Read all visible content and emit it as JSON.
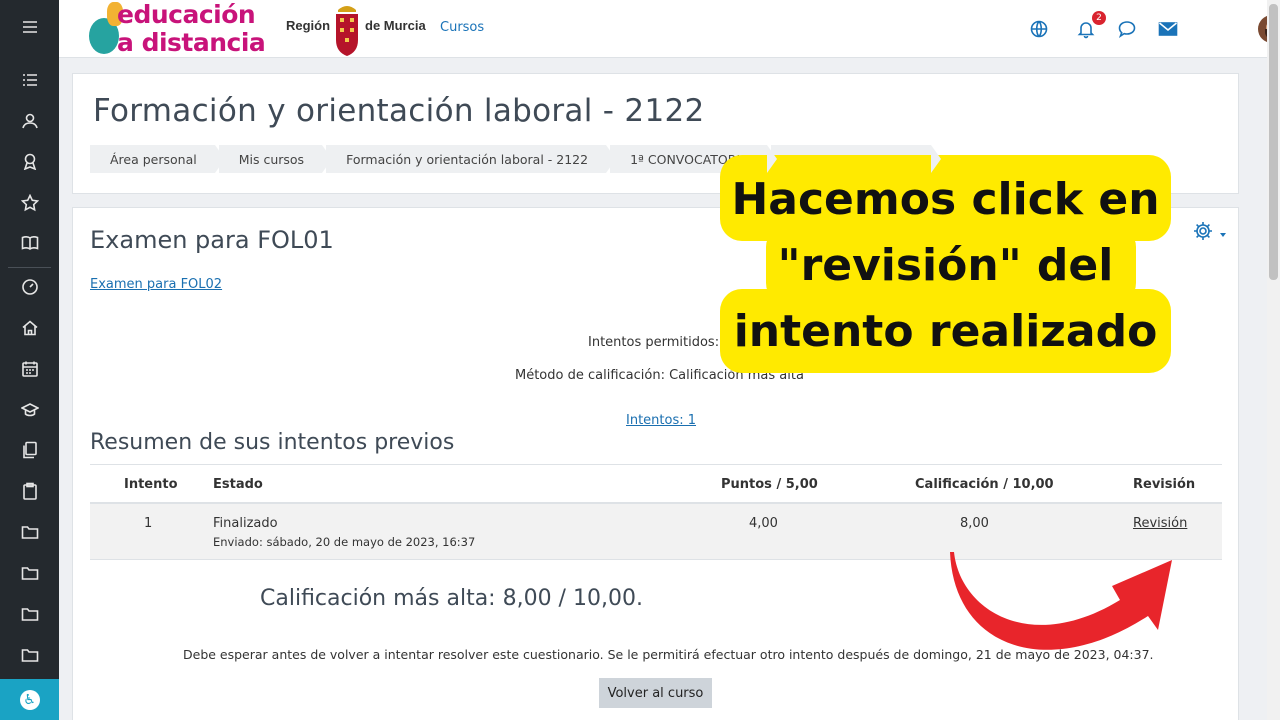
{
  "navbar": {
    "logo_line1": "educación",
    "logo_line2": "a distancia",
    "region_left": "Región",
    "region_right": "de Murcia",
    "cursos_link": "Cursos",
    "notification_count": "2"
  },
  "header": {
    "title": "Formación y orientación laboral - 2122",
    "breadcrumbs": [
      "Área personal",
      "Mis cursos",
      "Formación y orientación laboral - 2122",
      "1ª CONVOCATORIA"
    ]
  },
  "quiz": {
    "title": "Examen para FOL01",
    "next_link": "Examen para FOL02",
    "attempts_allowed": "Intentos permitidos: 3",
    "grading_method": "Método de calificación: Calificación más alta",
    "attempts_link": "Intentos: 1",
    "summary_title": "Resumen de sus intentos previos",
    "table": {
      "headers": [
        "Intento",
        "Estado",
        "Puntos / 5,00",
        "Calificación / 10,00",
        "Revisión"
      ],
      "rows": [
        {
          "attempt": "1",
          "state": "Finalizado",
          "submitted": "Enviado: sábado, 20 de mayo de 2023, 16:37",
          "points": "4,00",
          "grade": "8,00",
          "review": "Revisión"
        }
      ]
    },
    "best_grade": "Calificación más alta: 8,00 / 10,00.",
    "wait_message": "Debe esperar antes de volver a intentar resolver este cuestionario. Se le permitirá efectuar otro intento después de domingo, 21 de mayo de 2023, 04:37.",
    "back_button": "Volver al curso"
  },
  "overlay": {
    "line1": "Hacemos click en",
    "line2": "\"revisión\" del",
    "line3": "intento realizado",
    "highlight_color": "#ffea00",
    "arrow_color": "#e8252b"
  },
  "colors": {
    "sidebar": "#24292e",
    "link": "#1a6fb0",
    "accent": "#1aa3c4"
  }
}
